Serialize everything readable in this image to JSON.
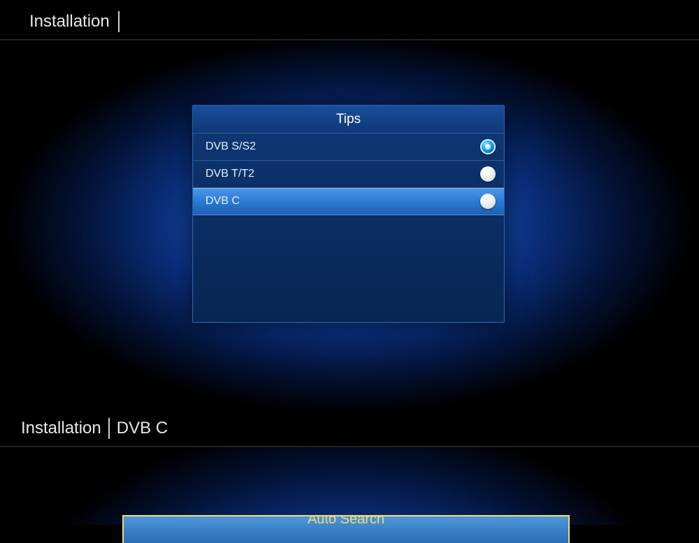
{
  "top": {
    "title": "Installation",
    "dialog": {
      "title": "Tips",
      "options": [
        {
          "label": "DVB S/S2",
          "selected": true,
          "highlighted": false
        },
        {
          "label": "DVB T/T2",
          "selected": false,
          "highlighted": false
        },
        {
          "label": "DVB C",
          "selected": false,
          "highlighted": true
        }
      ]
    }
  },
  "bottom": {
    "breadcrumb": {
      "root": "Installation",
      "current": "DVB C"
    },
    "button_label": "Auto Search"
  }
}
